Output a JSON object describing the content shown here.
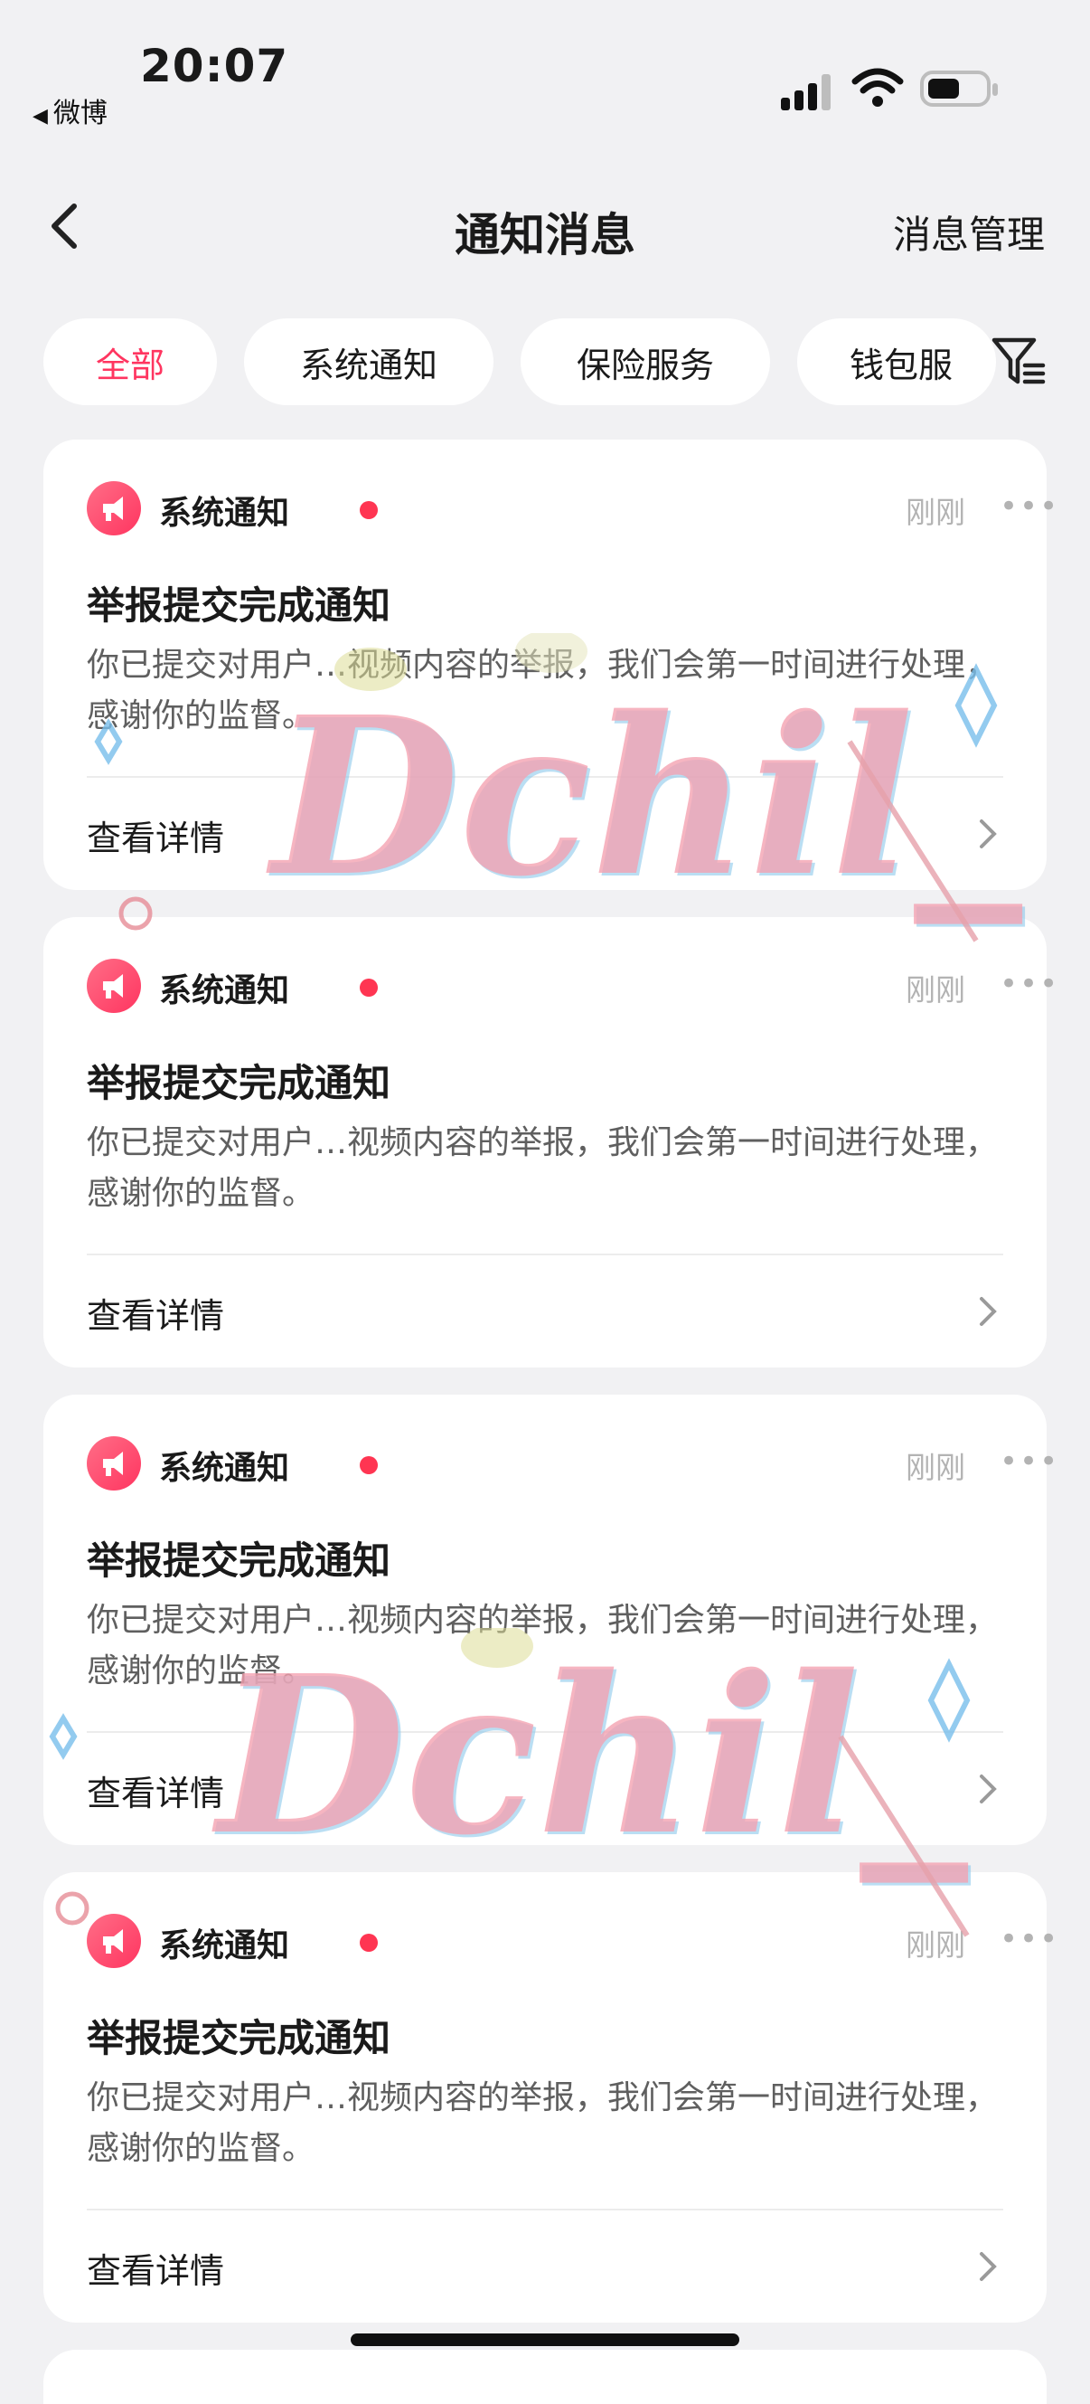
{
  "status_bar": {
    "time": "20:07",
    "back_app": "微博",
    "back_icon": "back-triangle-icon"
  },
  "nav": {
    "title": "通知消息",
    "manage": "消息管理"
  },
  "tabs": [
    {
      "label": "全部",
      "active": true
    },
    {
      "label": "系统通知",
      "active": false
    },
    {
      "label": "保险服务",
      "active": false
    },
    {
      "label": "钱包服",
      "active": false
    }
  ],
  "notifications": [
    {
      "category": "系统通知",
      "time": "刚刚",
      "title": "举报提交完成通知",
      "body": "你已提交对用户…视频内容的举报，我们会第一时间进行处理，感谢你的监督。",
      "detail": "查看详情"
    },
    {
      "category": "系统通知",
      "time": "刚刚",
      "title": "举报提交完成通知",
      "body": "你已提交对用户…视频内容的举报，我们会第一时间进行处理，感谢你的监督。",
      "detail": "查看详情"
    },
    {
      "category": "系统通知",
      "time": "刚刚",
      "title": "举报提交完成通知",
      "body": "你已提交对用户…视频内容的举报，我们会第一时间进行处理，感谢你的监督。",
      "detail": "查看详情"
    },
    {
      "category": "系统通知",
      "time": "刚刚",
      "title": "举报提交完成通知",
      "body": "你已提交对用户…视频内容的举报，我们会第一时间进行处理，感谢你的监督。",
      "detail": "查看详情"
    }
  ],
  "watermark": "Dchil_",
  "colors": {
    "accent": "#ff3560",
    "unread_dot": "#ff3552",
    "background": "#f1f1f3"
  }
}
